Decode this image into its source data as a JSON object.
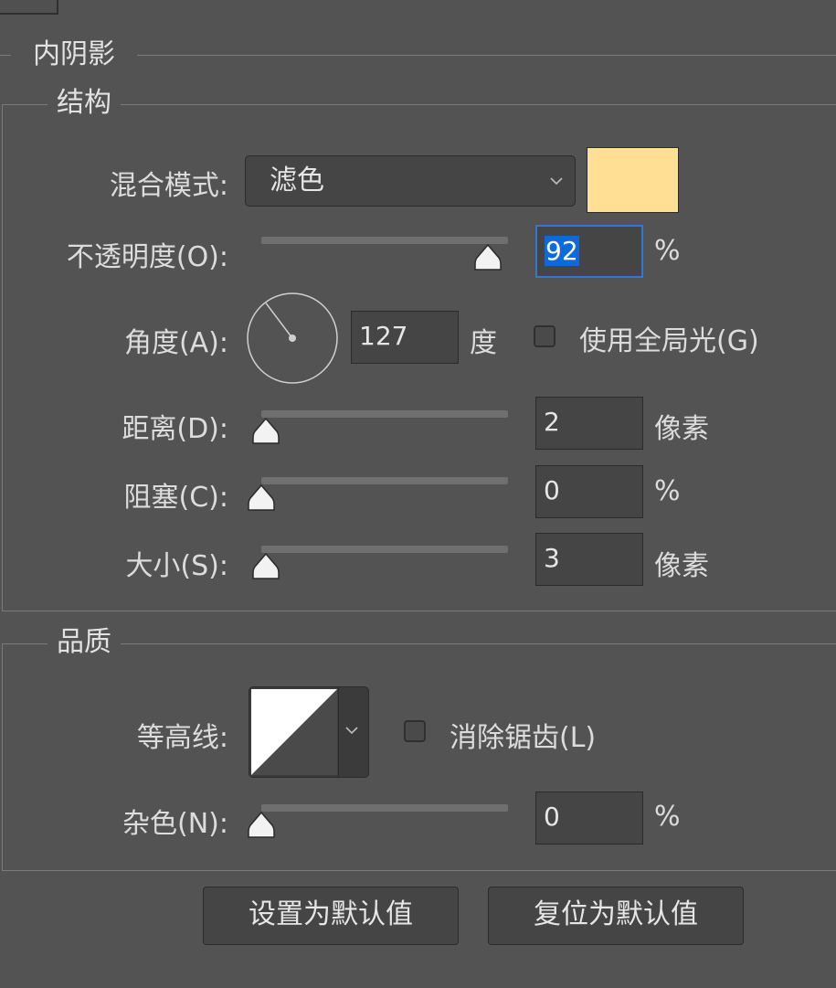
{
  "section": {
    "title": "内阴影"
  },
  "structure": {
    "title": "结构",
    "blend_mode": {
      "label": "混合模式:",
      "value": "滤色",
      "color": "#fedf94"
    },
    "opacity": {
      "label": "不透明度(O):",
      "value": "92",
      "unit": "%",
      "slider_fraction": 0.92
    },
    "angle": {
      "label": "角度(A):",
      "value": "127",
      "unit": "度",
      "degrees": 127,
      "global_light_label": "使用全局光(G)",
      "global_light_checked": false
    },
    "distance": {
      "label": "距离(D):",
      "value": "2",
      "unit": "像素",
      "slider_fraction": 0.02
    },
    "choke": {
      "label": "阻塞(C):",
      "value": "0",
      "unit": "%",
      "slider_fraction": 0.0
    },
    "size": {
      "label": "大小(S):",
      "value": "3",
      "unit": "像素",
      "slider_fraction": 0.02
    }
  },
  "quality": {
    "title": "品质",
    "contour": {
      "label": "等高线:",
      "anti_alias_label": "消除锯齿(L)",
      "anti_alias_checked": false
    },
    "noise": {
      "label": "杂色(N):",
      "value": "0",
      "unit": "%",
      "slider_fraction": 0.0
    }
  },
  "buttons": {
    "make_default": "设置为默认值",
    "reset_default": "复位为默认值"
  },
  "icons": {
    "dropdown": "chevron-down-icon",
    "slider_thumb": "slider-thumb-icon",
    "angle_dial": "angle-dial-icon",
    "contour_preview": "contour-linear-icon"
  }
}
